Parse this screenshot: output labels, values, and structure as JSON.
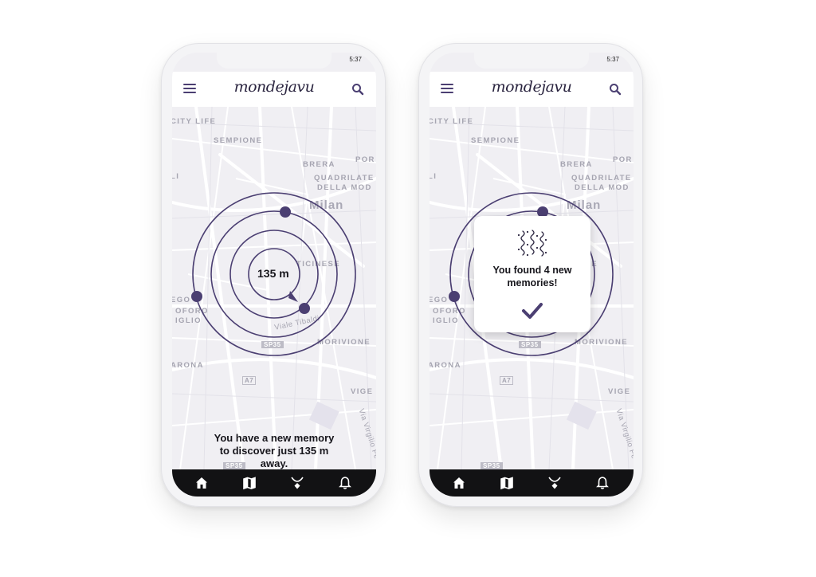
{
  "status": {
    "time": "5:37"
  },
  "app": {
    "logo_text": "mondejavu"
  },
  "map_labels": {
    "city_life": "CITY LIFE",
    "sempione": "SEMPIONE",
    "brera": "BRERA",
    "por": "POR",
    "quadrilatero": "QUADRILATE",
    "della_moda": "DELLA MOD",
    "milan": "Milan",
    "li": "LI",
    "ticinese": "TICINESE",
    "ego": "EGO",
    "oforo": "OFORO",
    "iglio": "IGLIO",
    "viale_tibaldi": "Viale Tibaldi",
    "sp35": "SP35",
    "a7": "A7",
    "morivione": "MORIVIONE",
    "arona": "ARONA",
    "vige": "VIGE",
    "via_virgilio": "Via Virgilio Fe",
    "sp35b": "SP35"
  },
  "screen1": {
    "distance": "135 m",
    "message_line1": "You have a new memory",
    "message_line2": "to discover just 135 m",
    "message_line3": "away."
  },
  "screen2": {
    "popup_line1": "You found 4 new",
    "popup_line2": "memories!"
  },
  "nav": [
    "home-icon",
    "map-icon",
    "necklace-icon",
    "bell-icon"
  ],
  "colors": {
    "accent": "#4b3f72",
    "map_bg": "#f0eff3",
    "nav_bg": "#121214"
  }
}
